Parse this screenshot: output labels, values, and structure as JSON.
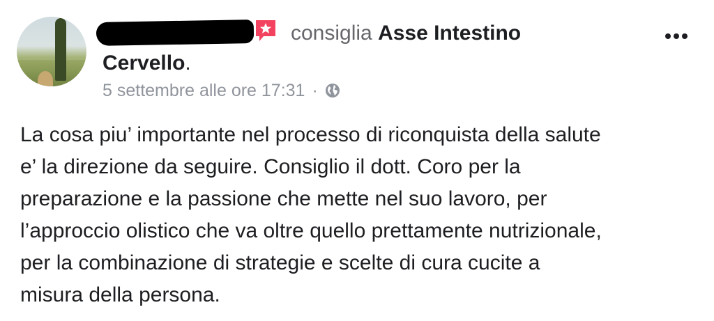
{
  "post": {
    "verb": "consiglia",
    "page_name_part1": "Asse Intestino",
    "page_name_part2": "Cervello",
    "period": ".",
    "timestamp": "5 settembre alle ore 17:31",
    "separator": "·",
    "privacy_icon": "globe-icon",
    "recommend_icon": "star-flag-icon",
    "recommend_color": "#f3425f",
    "body_lines": [
      "La cosa piu’ importante nel processo di riconquista della salute",
      "e’ la direzione da seguire. Consiglio il dott. Coro per la",
      "preparazione e la passione che mette nel suo lavoro, per",
      "l’approccio olistico che va oltre quello prettamente nutrizionale,",
      "per la combinazione di strategie e scelte di cura cucite a",
      "misura della persona."
    ]
  }
}
